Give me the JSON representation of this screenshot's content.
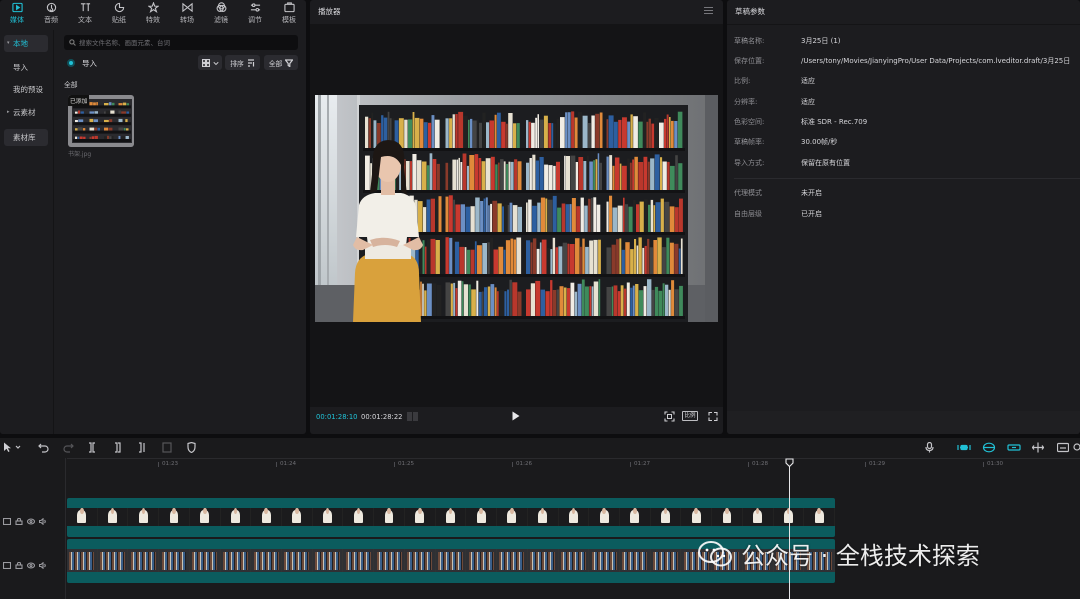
{
  "categories": [
    {
      "label": "媒体",
      "icon": "media-icon",
      "active": true
    },
    {
      "label": "音频",
      "icon": "audio-icon"
    },
    {
      "label": "文本",
      "icon": "text-icon"
    },
    {
      "label": "贴纸",
      "icon": "sticker-icon"
    },
    {
      "label": "特效",
      "icon": "effects-icon"
    },
    {
      "label": "转场",
      "icon": "transition-icon"
    },
    {
      "label": "滤镜",
      "icon": "filter-icon"
    },
    {
      "label": "调节",
      "icon": "adjust-icon"
    },
    {
      "label": "模板",
      "icon": "template-icon"
    }
  ],
  "media": {
    "nav": {
      "local": "本地",
      "import": "导入",
      "presets": "我的预设",
      "cloud": "云素材",
      "library": "素材库"
    },
    "search_placeholder": "搜索文件名称、画面元素、台词",
    "import_label": "导入",
    "sort_label": "排序",
    "filter_label": "全部",
    "section_all": "全部",
    "item": {
      "badge": "已添加",
      "name": "书架.jpg"
    }
  },
  "player": {
    "title": "播放器",
    "current_time": "00:01:28:10",
    "total_time": "00:01:28:22",
    "ratio_label": "比例"
  },
  "params": {
    "title": "草稿参数",
    "rows": [
      {
        "label": "草稿名称:",
        "value": "3月25日 (1)"
      },
      {
        "label": "保存位置:",
        "value": "/Users/tony/Movies/JianyingPro/User Data/Projects/com.lveditor.draft/3月25日"
      },
      {
        "label": "比例:",
        "value": "适应"
      },
      {
        "label": "分辨率:",
        "value": "适应"
      },
      {
        "label": "色彩空间:",
        "value": "标准 SDR - Rec.709"
      },
      {
        "label": "草稿帧率:",
        "value": "30.00帧/秒"
      },
      {
        "label": "导入方式:",
        "value": "保留在原有位置"
      }
    ],
    "rows2": [
      {
        "label": "代理模式",
        "value": "未开启"
      },
      {
        "label": "自由层级",
        "value": "已开启"
      }
    ]
  },
  "timeline": {
    "ticks": [
      "01:23",
      "01:24",
      "01:25",
      "01:26",
      "01:27",
      "01:28",
      "01:29",
      "01:30"
    ],
    "accent": "#21c1d6"
  },
  "watermark": {
    "text": "公众号 · 全栈技术探索"
  }
}
